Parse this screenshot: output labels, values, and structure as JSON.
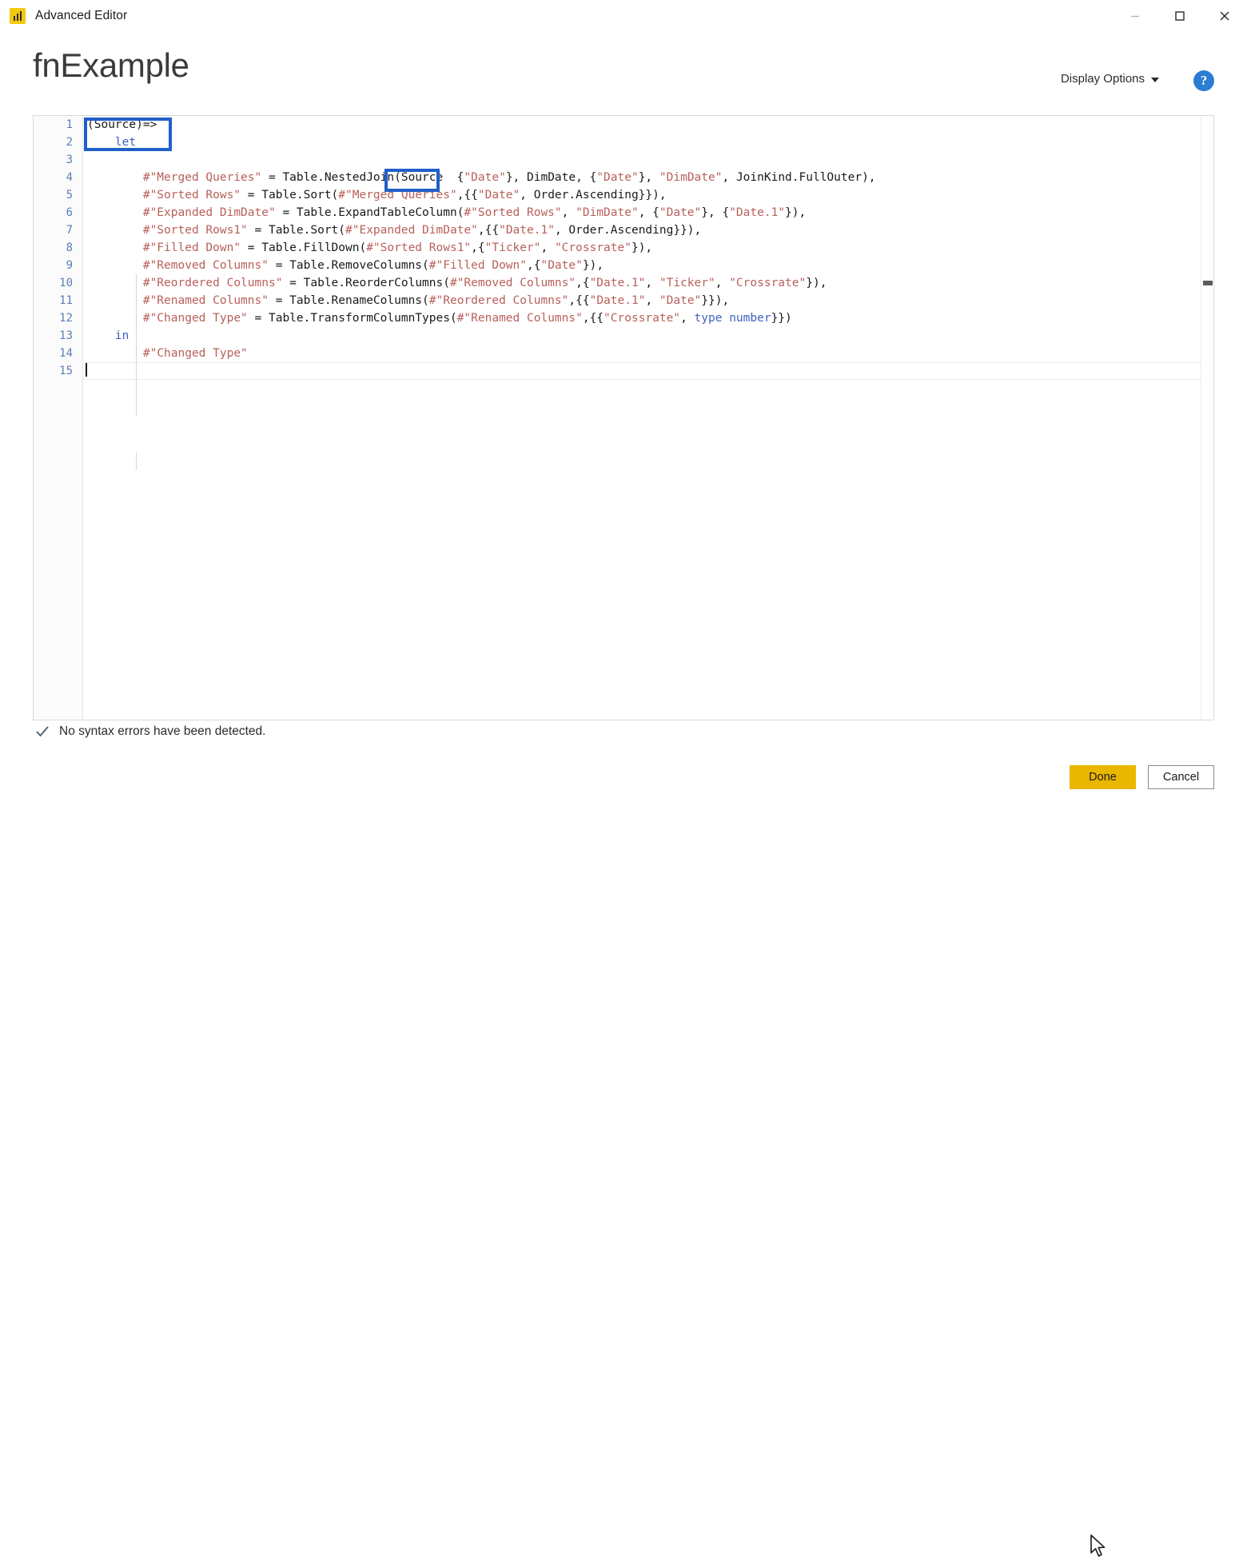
{
  "window": {
    "title": "Advanced Editor",
    "app_icon": "powerbi-icon",
    "minimize_label": "–",
    "maximize_label": "□",
    "close_label": "✕"
  },
  "header": {
    "function_name": "fnExample",
    "display_options_label": "Display Options",
    "help_label": "?"
  },
  "editor": {
    "line_numbers": [
      "1",
      "2",
      "3",
      "4",
      "5",
      "6",
      "7",
      "8",
      "9",
      "10",
      "11",
      "12",
      "13",
      "14",
      "15"
    ],
    "lines": [
      "(Source)=>",
      "    let",
      "",
      "        #\"Merged Queries\" = Table.NestedJoin(Source  {\"Date\"}, DimDate, {\"Date\"}, \"DimDate\", JoinKind.FullOuter),",
      "        #\"Sorted Rows\" = Table.Sort(#\"Merged Queries\",{{\"Date\", Order.Ascending}}),",
      "        #\"Expanded DimDate\" = Table.ExpandTableColumn(#\"Sorted Rows\", \"DimDate\", {\"Date\"}, {\"Date.1\"}),",
      "        #\"Sorted Rows1\" = Table.Sort(#\"Expanded DimDate\",{{\"Date.1\", Order.Ascending}}),",
      "        #\"Filled Down\" = Table.FillDown(#\"Sorted Rows1\",{\"Ticker\", \"Crossrate\"}),",
      "        #\"Removed Columns\" = Table.RemoveColumns(#\"Filled Down\",{\"Date\"}),",
      "        #\"Reordered Columns\" = Table.ReorderColumns(#\"Removed Columns\",{\"Date.1\", \"Ticker\", \"Crossrate\"}),",
      "        #\"Renamed Columns\" = Table.RenameColumns(#\"Reordered Columns\",{{\"Date.1\", \"Date\"}}),",
      "        #\"Changed Type\" = Table.TransformColumnTypes(#\"Renamed Columns\",{{\"Crossrate\", type number}})",
      "    in",
      "        #\"Changed Type\"",
      ""
    ],
    "highlight_boxes": [
      {
        "name": "source-parameter-highlight",
        "text": "(Source)=>"
      },
      {
        "name": "source-reference-highlight",
        "text": "Source"
      }
    ],
    "highlight_color": "#1f5fc9"
  },
  "status": {
    "icon": "checkmark-icon",
    "message": "No syntax errors have been detected."
  },
  "footer": {
    "done_label": "Done",
    "cancel_label": "Cancel",
    "done_color": "#eab700"
  }
}
